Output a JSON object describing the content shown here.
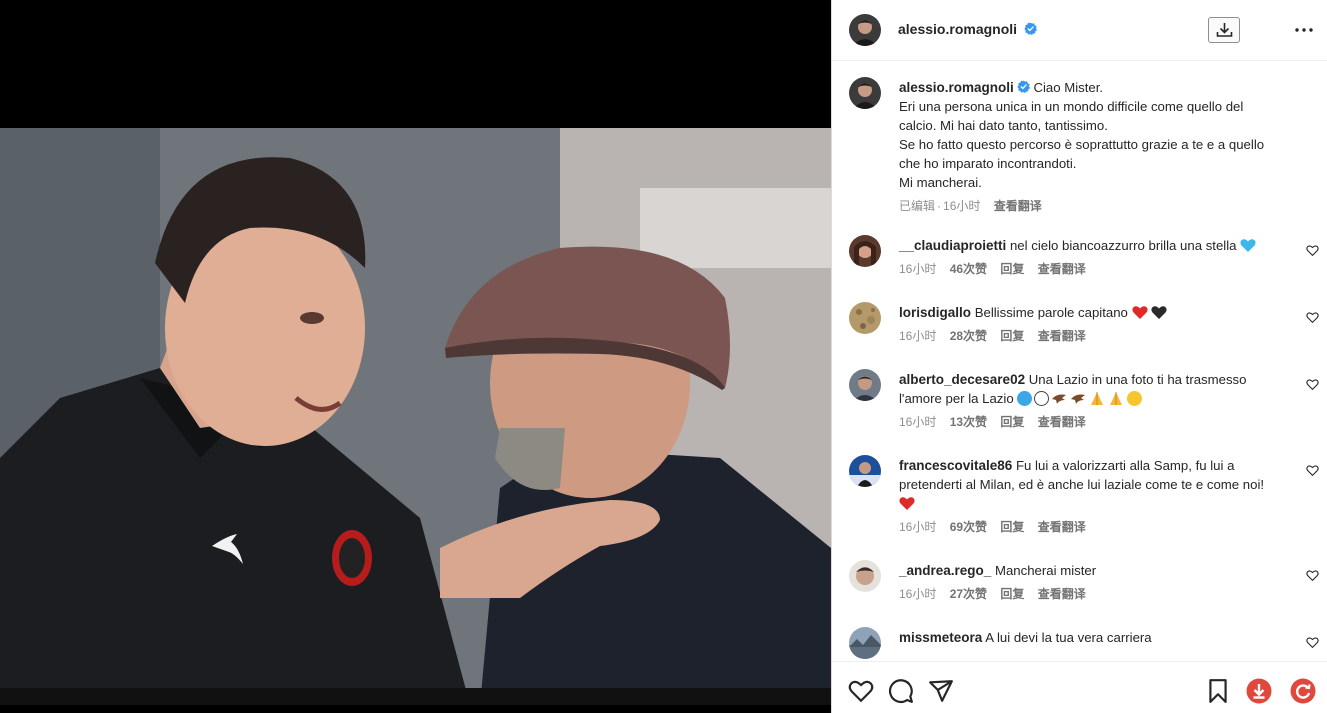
{
  "post": {
    "username": "alessio.romagnoli",
    "caption_lines": [
      "Ciao Mister.",
      "Eri una persona unica in un mondo difficile come quello del",
      "calcio. Mi hai dato tanto, tantissimo.",
      "Se ho fatto questo percorso è soprattutto grazie a te e a quello",
      "che ho imparato incontrandoti.",
      "Mi mancherai."
    ],
    "edited_label": "已编辑",
    "time": "16小时",
    "translate_label": "查看翻译"
  },
  "comments": [
    {
      "username": "__claudiaproietti",
      "text": "nel cielo biancoazzurro brilla una stella",
      "time": "16小时",
      "likes": "46次赞",
      "reply": "回复",
      "translate": "查看翻译"
    },
    {
      "username": "lorisdigallo",
      "text": "Bellissime parole capitano",
      "time": "16小时",
      "likes": "28次赞",
      "reply": "回复",
      "translate": "查看翻译"
    },
    {
      "username": "alberto_decesare02",
      "text": "Una Lazio in una foto ti ha trasmesso",
      "text2": "l'amore per la Lazio",
      "time": "16小时",
      "likes": "13次赞",
      "reply": "回复",
      "translate": "查看翻译"
    },
    {
      "username": "francescovitale86",
      "text": "Fu lui a valorizzarti alla Samp, fu lui a",
      "text2": "pretenderti al Milan, ed è anche lui laziale come te e come noi!",
      "time": "16小时",
      "likes": "69次赞",
      "reply": "回复",
      "translate": "查看翻译"
    },
    {
      "username": "_andrea.rego_",
      "text": "Mancherai mister",
      "time": "16小时",
      "likes": "27次赞",
      "reply": "回复",
      "translate": "查看翻译"
    },
    {
      "username": "missmeteora",
      "text": "A lui devi la tua vera carriera"
    }
  ],
  "colors": {
    "verified": "#3897f0",
    "text": "#262626",
    "muted": "#8e8e8e",
    "download_red": "#e0483e"
  }
}
